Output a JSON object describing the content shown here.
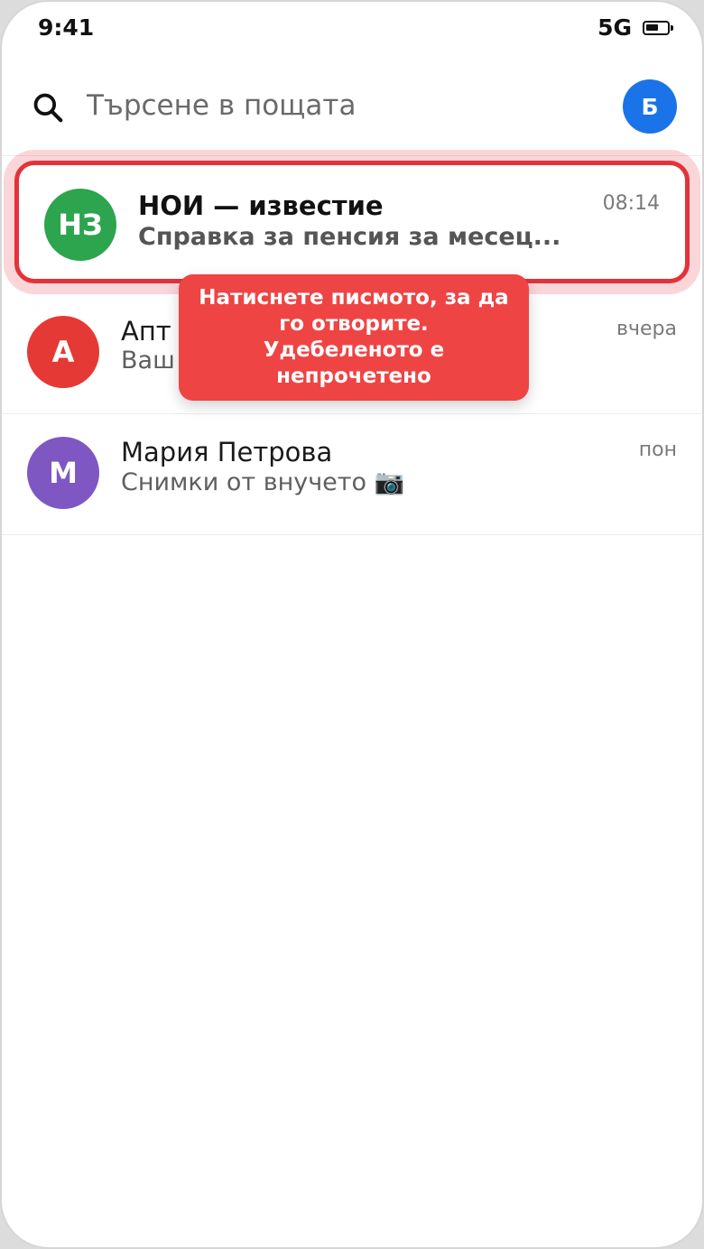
{
  "status_bar": {
    "time": "9:41",
    "network": "5G",
    "battery_icon": "battery-icon"
  },
  "search": {
    "icon": "search-icon",
    "placeholder": "Търсене в пощата",
    "account_initial": "Б",
    "account_color": "#1a73e8"
  },
  "mails": [
    {
      "initials": "НЗ",
      "avatar_color": "#2da44e",
      "sender": "НОИ — известие",
      "snippet": "Справка за пенсия за месец...",
      "time": "08:14",
      "unread": true,
      "highlighted": true
    },
    {
      "initials": "А",
      "avatar_color": "#e53935",
      "sender": "Апт",
      "snippet": "Ваш",
      "time": "вчера",
      "unread": false
    },
    {
      "initials": "М",
      "avatar_color": "#7e57c2",
      "sender": "Мария Петрова",
      "snippet": "Снимки от внучето 📷",
      "time": "пон",
      "unread": false
    }
  ],
  "tooltip": {
    "text": "Натиснете писмото, за да го отворите. Удебеленото е непрочетено",
    "color": "#ef4444"
  },
  "highlight_color": "#e5323a"
}
